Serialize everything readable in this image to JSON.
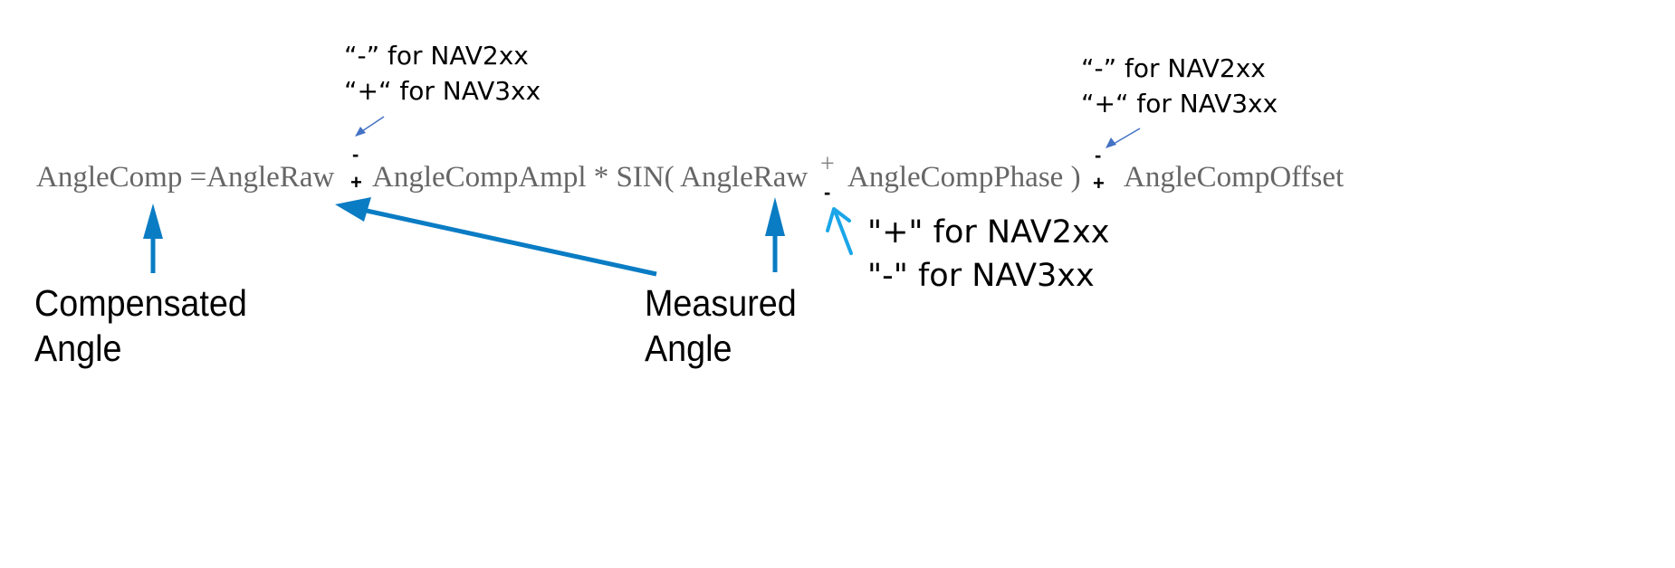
{
  "formula": {
    "lhs": "AngleComp =AngleRaw",
    "term_ampl": "AngleCompAmpl * SIN( AngleRaw",
    "term_phase": "AngleCompPhase )",
    "term_offset": "AngleCompOffset",
    "sign1": {
      "top": "-",
      "bottom": "+"
    },
    "sign2": {
      "top": "+",
      "bottom": "-"
    },
    "sign3": {
      "top": "-",
      "bottom": "+"
    }
  },
  "annotations": {
    "note1": {
      "line1": "“-” for NAV2xx",
      "line2": "“+“ for NAV3xx"
    },
    "note2": {
      "line1": "“-” for NAV2xx",
      "line2": "“+“ for NAV3xx"
    },
    "note3": {
      "line1": "\"+\" for NAV2xx",
      "line2": "\"-\" for NAV3xx"
    }
  },
  "labels": {
    "compensated": {
      "line1": "Compensated",
      "line2": "Angle"
    },
    "measured": {
      "line1": "Measured",
      "line2": "Angle"
    }
  },
  "colors": {
    "arrow_main": "#0A7CC4",
    "arrow_thin": "#4472C4",
    "arrow_handdrawn": "#1AA6E8",
    "formula_text": "#666666"
  }
}
